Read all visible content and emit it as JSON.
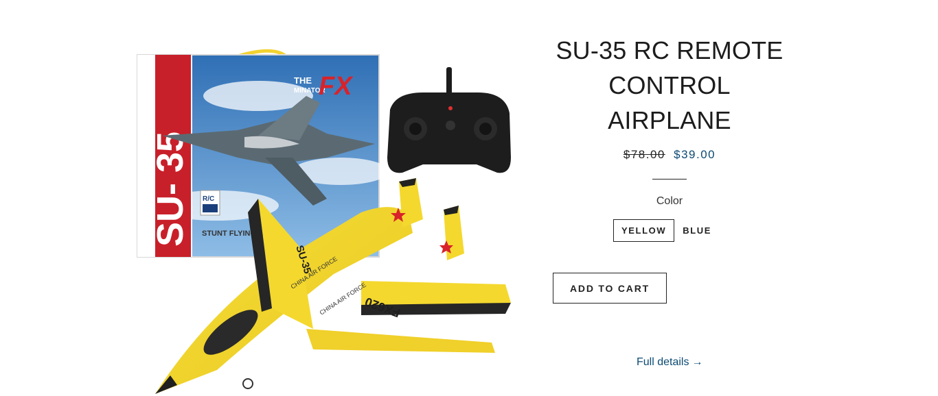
{
  "product": {
    "title": "SU-35 RC REMOTE CONTROL AIRPLANE",
    "price_original": "$78.00",
    "price_sale": "$39.00",
    "color_label": "Color",
    "color_options": [
      "YELLOW",
      "BLUE"
    ],
    "selected_color": "YELLOW",
    "add_to_cart_label": "ADD TO CART",
    "full_details_label": "Full details",
    "full_details_arrow": "→"
  },
  "image": {
    "box_model_text": "SU- 35",
    "box_brand_the": "THE",
    "box_brand_fx": "FX",
    "box_brand_minator": "MINATOR",
    "box_rc_badge": "R/C",
    "box_bottom_text": "STUNT FLYING AI",
    "plane_nose_text": "SU-35",
    "plane_wing_text_1": "CHINA AIR FORCE",
    "plane_wing_text_2": "CHINA AIR FORCE",
    "plane_model_text": "FX620"
  },
  "colors": {
    "accent_price": "#0b4a73",
    "box_red": "#c8202a",
    "plane_yellow": "#f2d325"
  }
}
